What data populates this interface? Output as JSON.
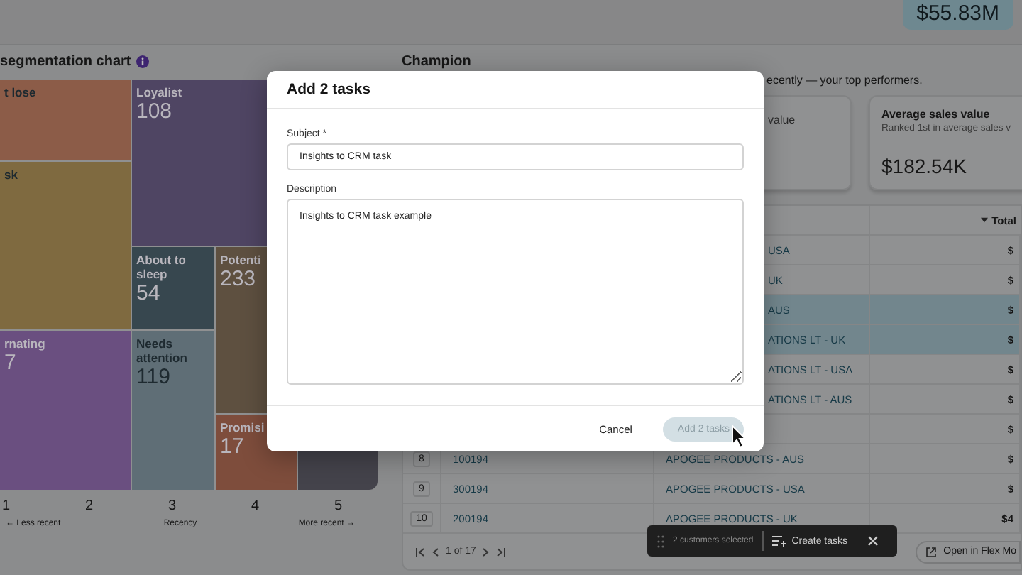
{
  "header": {
    "total_badge": "$55.83M"
  },
  "segmentation": {
    "title": "segmentation chart",
    "tiles": [
      {
        "label": "t lose",
        "color": "#8c5c48"
      },
      {
        "label": "sk",
        "color": "#7f6a40"
      },
      {
        "label": "rnating",
        "value": "7",
        "color": "#6a4f80"
      },
      {
        "label": "Loyalist",
        "value": "108",
        "color": "#4f4563"
      },
      {
        "label": "About to sleep",
        "value": "54",
        "color": "#37474f"
      },
      {
        "label": "Potenti",
        "value": "233",
        "color": "#5e5040"
      },
      {
        "label": "Needs attention",
        "value": "119",
        "color": "#5f6e76"
      },
      {
        "label": "Promisi",
        "value": "17",
        "color": "#7e4d3c"
      },
      {
        "color": "#44434b"
      }
    ],
    "axis": {
      "ticks": [
        "1",
        "2",
        "3",
        "4",
        "5"
      ],
      "left": "← Less recent",
      "center": "Recency",
      "right": "More recent →"
    }
  },
  "champion": {
    "title": "Champion",
    "subtitle": "ecently — your top performers.",
    "cards": [
      {
        "title": "value",
        "covered": true
      },
      {
        "title": "Average sales value",
        "subtitle": "Ranked 1st in average sales v",
        "value": "$182.54K",
        "covered": false
      }
    ]
  },
  "table": {
    "total_header": "Total",
    "rows": [
      {
        "name": "USA",
        "total": "$",
        "selected": false,
        "covered": true
      },
      {
        "name": "UK",
        "total": "$",
        "selected": false,
        "covered": true
      },
      {
        "name": "AUS",
        "total": "$",
        "selected": true,
        "covered": true
      },
      {
        "name": "ATIONS LT - UK",
        "total": "$",
        "selected": true,
        "covered": true
      },
      {
        "name": "ATIONS LT - USA",
        "total": "$",
        "selected": false,
        "covered": true
      },
      {
        "name": "ATIONS LT - AUS",
        "total": "$",
        "selected": false,
        "covered": true
      },
      {
        "total": "$",
        "selected": false
      },
      {
        "number": "8",
        "id": "100194",
        "name": "APOGEE PRODUCTS - AUS",
        "total": "$",
        "selected": false,
        "covered": false
      },
      {
        "number": "9",
        "id": "300194",
        "name": "APOGEE PRODUCTS - USA",
        "total": "$",
        "selected": false,
        "covered": false
      },
      {
        "number": "10",
        "id": "200194",
        "name": "APOGEE PRODUCTS - UK",
        "total": "$4",
        "selected": false,
        "covered": false
      }
    ]
  },
  "pager": {
    "text": "1 of 17"
  },
  "open_button": "Open in Flex Mo",
  "selection_bar": {
    "count": "2 customers selected",
    "action": "Create tasks"
  },
  "dialog": {
    "title": "Add 2 tasks",
    "fields": [
      {
        "kind": "input",
        "label": "Subject *",
        "value": "Insights to CRM task"
      },
      {
        "kind": "textarea",
        "label": "Description",
        "value": "Insights to CRM task example"
      }
    ],
    "cancel": "Cancel",
    "submit": {
      "label": "Add 2 tasks",
      "disabled": true
    }
  }
}
